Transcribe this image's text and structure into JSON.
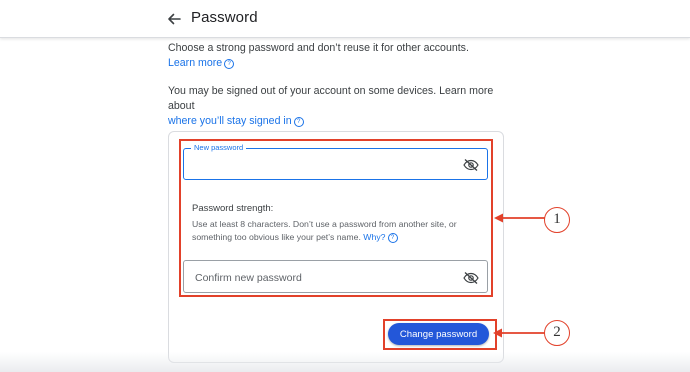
{
  "header": {
    "title": "Password",
    "back_icon": "arrow-left-icon"
  },
  "intro": {
    "line1": "Choose a strong password and don’t reuse it for other accounts.",
    "learn_more": "Learn more",
    "line2": "You may be signed out of your account on some devices. Learn more about",
    "stay_signed_in": "where you’ll stay signed in"
  },
  "form": {
    "new_password_label": "New password",
    "new_password_value": "",
    "strength_label": "Password strength:",
    "strength_hint": "Use at least 8 characters. Don’t use a password from another site, or something too obvious like your pet’s name.",
    "why_link": "Why?",
    "confirm_placeholder": "Confirm new password",
    "confirm_value": "",
    "submit_label": "Change password",
    "eye_icon": "visibility-off-icon"
  },
  "annotations": {
    "callout1": "1",
    "callout2": "2",
    "color": "#e2412a"
  },
  "colors": {
    "accent": "#1a73e8",
    "button": "#2357d9"
  }
}
